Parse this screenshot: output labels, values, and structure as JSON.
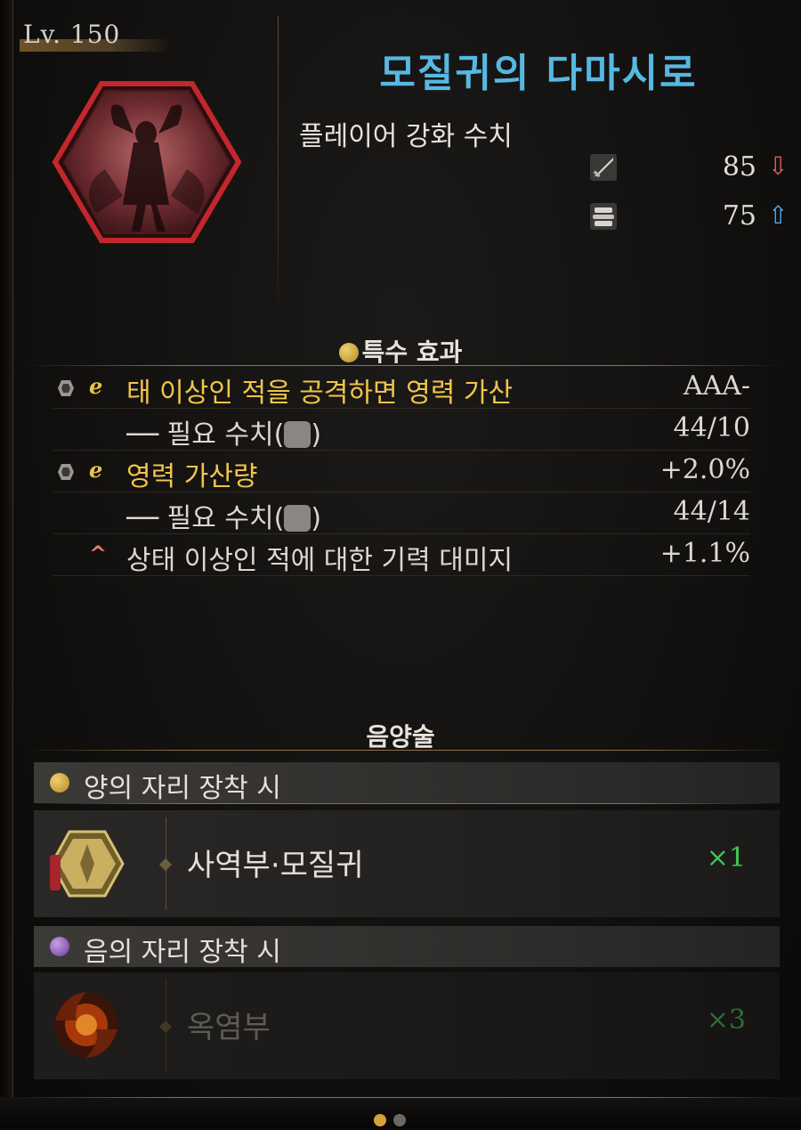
{
  "header": {
    "level": "Lv. 150",
    "title": "모질귀의 다마시로",
    "subtitle": "플레이어 강화 수치"
  },
  "stats": [
    {
      "icon": "sword-icon",
      "value": "85",
      "trend": "down",
      "arrow": "⇩"
    },
    {
      "icon": "armor-icon",
      "value": "75",
      "trend": "up",
      "arrow": "⇧"
    }
  ],
  "special": {
    "heading": "특수 효과",
    "rows": [
      {
        "text": "태 이상인 적을 공격하면 영력 가산",
        "value": "AAA-",
        "style": "gold"
      },
      {
        "text": "── 필요 수치(",
        "text2": ")",
        "value": "44/10",
        "style": "plain"
      },
      {
        "text": "영력 가산량",
        "value": "+2.0%",
        "style": "gold"
      },
      {
        "text": "── 필요 수치(",
        "text2": ")",
        "value": "44/14",
        "style": "plain"
      },
      {
        "text": "상태 이상인 적에 대한 기력 대미지",
        "value": "+1.1%",
        "style": "plain"
      }
    ]
  },
  "onmyo": {
    "heading": "음양술",
    "yang_label": "양의 자리 장착 시",
    "yang_item": {
      "name": "사역부·모질귀",
      "count": "×1"
    },
    "yin_label": "음의 자리 장착 시",
    "yin_item": {
      "name": "옥염부",
      "count": "×3"
    }
  },
  "pagination": {
    "active_color": "#d4a23a",
    "inactive_color": "#6b6864"
  },
  "colors": {
    "title": "#57b8e0",
    "gold": "#f1c54b",
    "count": "#3fc653",
    "down": "#e2604f",
    "up": "#5aa6e6"
  }
}
